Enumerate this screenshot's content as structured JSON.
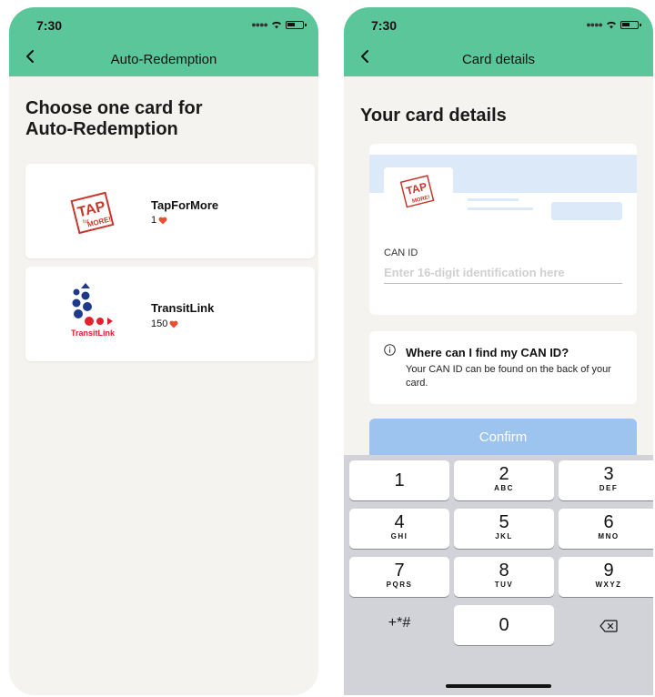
{
  "left": {
    "status": {
      "time": "7:30"
    },
    "nav": {
      "title": "Auto-Redemption"
    },
    "heading": [
      "Choose one card for",
      "Auto-Redemption"
    ],
    "cards": [
      {
        "name": "TapForMore",
        "points": "1"
      },
      {
        "name": "TransitLink",
        "points": "150"
      }
    ],
    "logos": {
      "tapformore": [
        "TAP",
        "for",
        "MORE!"
      ],
      "transitlink": "TransitLink"
    }
  },
  "right": {
    "status": {
      "time": "7:30"
    },
    "nav": {
      "title": "Card details"
    },
    "heading": "Your card details",
    "can_label": "CAN ID",
    "can_placeholder": "Enter 16-digit identification here",
    "info": {
      "title": "Where can I find my CAN ID?",
      "body": "Your CAN ID can be found on the back of your card."
    },
    "confirm_label": "Confirm",
    "keypad": [
      {
        "num": "1",
        "letters": ""
      },
      {
        "num": "2",
        "letters": "ABC"
      },
      {
        "num": "3",
        "letters": "DEF"
      },
      {
        "num": "4",
        "letters": "GHI"
      },
      {
        "num": "5",
        "letters": "JKL"
      },
      {
        "num": "6",
        "letters": "MNO"
      },
      {
        "num": "7",
        "letters": "PQRS"
      },
      {
        "num": "8",
        "letters": "TUV"
      },
      {
        "num": "9",
        "letters": "WXYZ"
      },
      {
        "num": "+*#",
        "letters": ""
      },
      {
        "num": "0",
        "letters": ""
      }
    ]
  },
  "colors": {
    "header_green": "#5bc69a",
    "heart": "#e8502f",
    "confirm_disabled": "#9cc4ee",
    "card_preview": "#dbe9f8"
  }
}
